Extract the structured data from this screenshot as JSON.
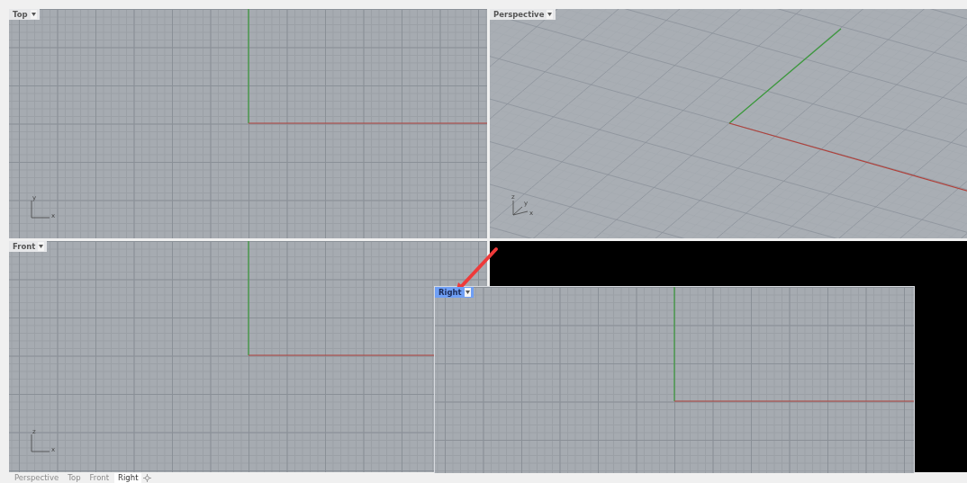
{
  "viewports": [
    {
      "title": "Top",
      "kind": "plan",
      "selected": false,
      "axis_labels": [
        "y",
        "x"
      ]
    },
    {
      "title": "Perspective",
      "kind": "perspective",
      "selected": false,
      "axis_labels": [
        "z",
        "y",
        "x"
      ]
    },
    {
      "title": "Front",
      "kind": "plan",
      "selected": false,
      "axis_labels": [
        "z",
        "x"
      ]
    }
  ],
  "floating_viewport": {
    "title": "Right",
    "kind": "plan",
    "selected": true
  },
  "tabs": [
    {
      "label": "Perspective",
      "selected": false
    },
    {
      "label": "Top",
      "selected": false
    },
    {
      "label": "Front",
      "selected": false
    },
    {
      "label": "Right",
      "selected": true
    }
  ]
}
